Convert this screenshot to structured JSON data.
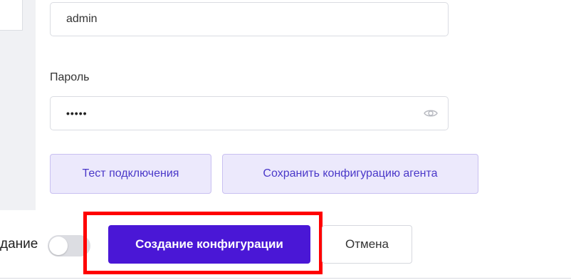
{
  "form": {
    "username_value": "admin",
    "password_label": "Пароль",
    "password_value": "•••••",
    "password_toggle_icon": "eye-icon",
    "test_connection_label": "Тест подключения",
    "save_agent_config_label": "Сохранить конфигурацию агента"
  },
  "footer": {
    "toggle_label": "дание",
    "toggle_on": false,
    "create_config_label": "Создание конфигурации",
    "cancel_label": "Отмена"
  },
  "colors": {
    "accent": "#4a17d6",
    "light_button_bg": "#ece9fc",
    "light_button_text": "#4a38c9",
    "highlight": "#ff0000"
  }
}
